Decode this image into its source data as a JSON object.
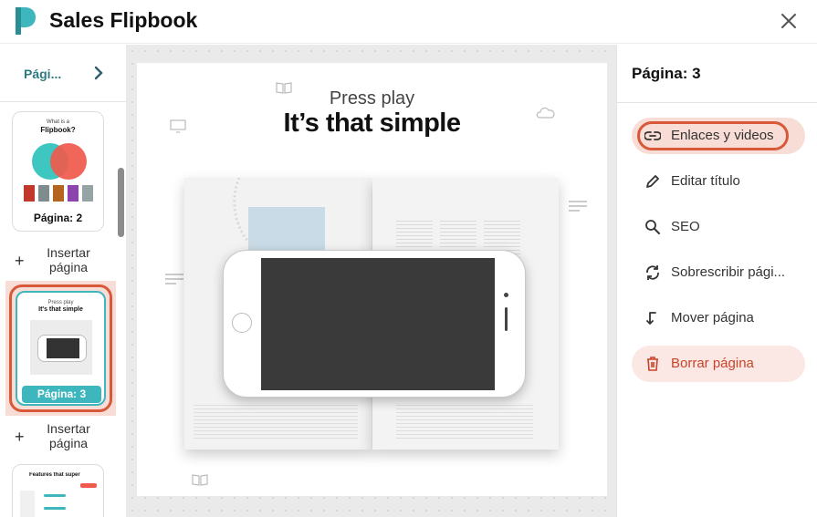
{
  "header": {
    "title": "Sales Flipbook",
    "logo_icon": "flipbook-logo-icon",
    "close_icon": "close-icon"
  },
  "sidebar": {
    "label": "Pági...",
    "next_icon": "chevron-right-icon",
    "thumbs": [
      {
        "label": "Página: 2",
        "heading_top": "What is a",
        "heading": "Flipbook?"
      },
      {
        "label": "Página: 3",
        "subtitle": "Press play",
        "title": "It's that simple"
      },
      {
        "heading": "Features that super"
      }
    ],
    "insert_label_line1": "Insertar",
    "insert_label_line2": "página"
  },
  "page": {
    "subtitle": "Press play",
    "title": "It’s that simple"
  },
  "panel": {
    "title": "Página: 3",
    "items": [
      {
        "label": "Enlaces y videos",
        "icon": "link-icon"
      },
      {
        "label": "Editar título",
        "icon": "pencil-icon"
      },
      {
        "label": "SEO",
        "icon": "search-icon"
      },
      {
        "label": "Sobrescribir pági...",
        "icon": "refresh-icon"
      },
      {
        "label": "Mover página",
        "icon": "move-arrow-icon"
      },
      {
        "label": "Borrar página",
        "icon": "trash-icon"
      }
    ]
  },
  "colors": {
    "accent": "#3db7bd",
    "highlight": "#d7593a",
    "danger": "#c8452b"
  }
}
